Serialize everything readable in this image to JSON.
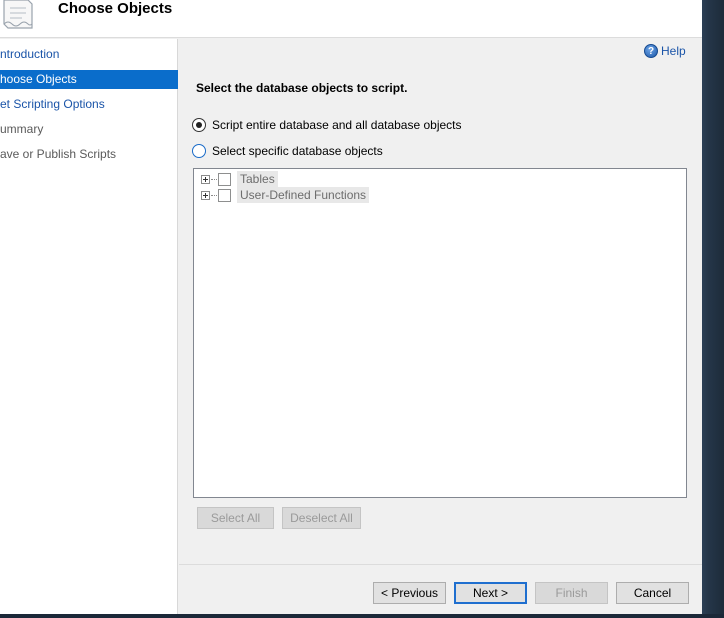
{
  "header": {
    "title": "Choose Objects"
  },
  "nav": {
    "items": [
      {
        "label": "ntroduction",
        "state": "link"
      },
      {
        "label": "hoose Objects",
        "state": "active"
      },
      {
        "label": "et Scripting Options",
        "state": "link"
      },
      {
        "label": "ummary",
        "state": "disabled"
      },
      {
        "label": "ave or Publish Scripts",
        "state": "disabled"
      }
    ]
  },
  "main": {
    "help_label": "Help",
    "heading": "Select the database objects to script.",
    "options": [
      {
        "label": "Script entire database and all database objects",
        "checked": true
      },
      {
        "label": "Select specific database objects",
        "checked": false
      }
    ],
    "tree": [
      {
        "label": "Tables",
        "checked": false
      },
      {
        "label": "User-Defined Functions",
        "checked": false
      }
    ],
    "select_all_label": "Select All",
    "deselect_all_label": "Deselect All"
  },
  "footer": {
    "previous_label": "< Previous",
    "next_label": "Next >",
    "finish_label": "Finish",
    "cancel_label": "Cancel"
  },
  "colors": {
    "nav_active_bg": "#0a6dcb",
    "link": "#1a54a8",
    "default_button_border": "#1f6fcf"
  }
}
